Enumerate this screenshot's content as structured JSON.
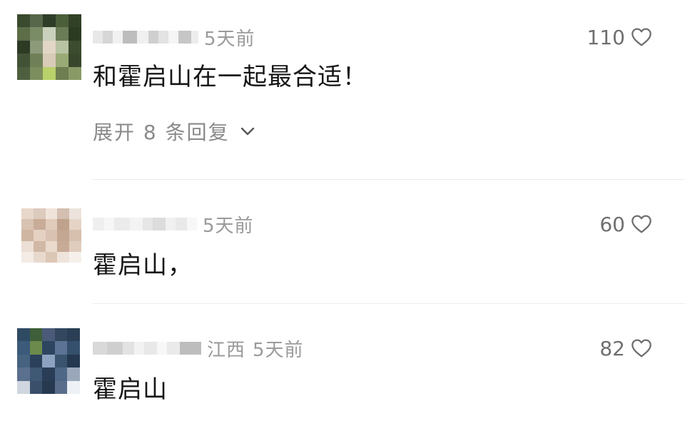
{
  "comments": [
    {
      "time": "5天前",
      "location": "",
      "content": "和霍启山在一起最合适！",
      "likes": "110",
      "expand_label": "展开 8 条回复"
    },
    {
      "time": "5天前",
      "location": "",
      "content": "霍启山，",
      "likes": "60"
    },
    {
      "time": "5天前",
      "location": "江西",
      "content": "霍启山",
      "likes": "82"
    }
  ],
  "icons": {
    "like": "heart-outline-icon",
    "expand": "chevron-down-icon"
  },
  "colors": {
    "meta_text": "#9a9a9a",
    "content_text": "#161616",
    "like_count": "#6f6f6f",
    "divider": "#ececec"
  }
}
